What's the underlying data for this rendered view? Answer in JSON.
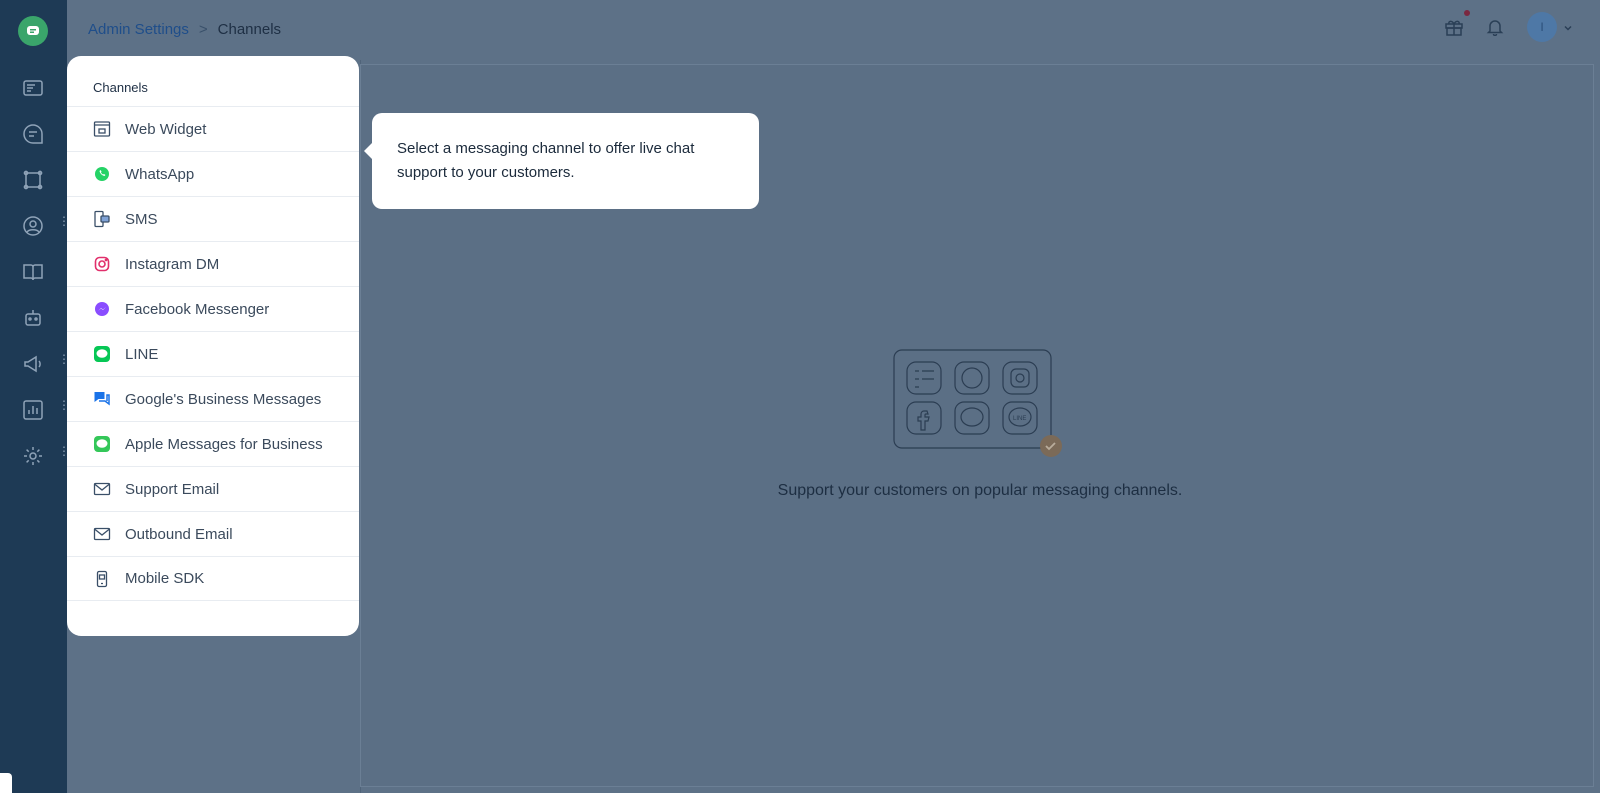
{
  "colors": {
    "rail": "#1e3a55",
    "overlay": "#5d7187",
    "brand": "#3aa56b",
    "panel": "#ffffff"
  },
  "sidebar": {
    "logo_icon": "chat-logo-icon",
    "items": [
      {
        "icon": "inbox-icon"
      },
      {
        "icon": "conversations-icon"
      },
      {
        "icon": "captain-icon"
      },
      {
        "icon": "contacts-icon"
      },
      {
        "icon": "help-center-icon"
      },
      {
        "icon": "bot-icon"
      },
      {
        "icon": "campaigns-icon"
      },
      {
        "icon": "reports-icon"
      },
      {
        "icon": "settings-icon"
      }
    ]
  },
  "header": {
    "breadcrumb": {
      "parent": "Admin Settings",
      "separator": ">",
      "current": "Channels"
    },
    "avatar_initial": "I"
  },
  "panel": {
    "title": "Channels",
    "items": [
      {
        "label": "Web Widget",
        "icon": "web-widget-icon"
      },
      {
        "label": "WhatsApp",
        "icon": "whatsapp-icon"
      },
      {
        "label": "SMS",
        "icon": "sms-icon"
      },
      {
        "label": "Instagram DM",
        "icon": "instagram-icon"
      },
      {
        "label": "Facebook Messenger",
        "icon": "messenger-icon"
      },
      {
        "label": "LINE",
        "icon": "line-icon"
      },
      {
        "label": "Google's Business Messages",
        "icon": "google-business-messages-icon"
      },
      {
        "label": "Apple Messages for Business",
        "icon": "apple-messages-icon"
      },
      {
        "label": "Support Email",
        "icon": "email-icon"
      },
      {
        "label": "Outbound Email",
        "icon": "email-icon"
      },
      {
        "label": "Mobile SDK",
        "icon": "mobile-sdk-icon"
      }
    ]
  },
  "tooltip": {
    "text": "Select a messaging channel to offer live chat support to your customers."
  },
  "empty_state": {
    "text": "Support your customers on popular messaging channels.",
    "icon": "channels-illustration-icon"
  }
}
